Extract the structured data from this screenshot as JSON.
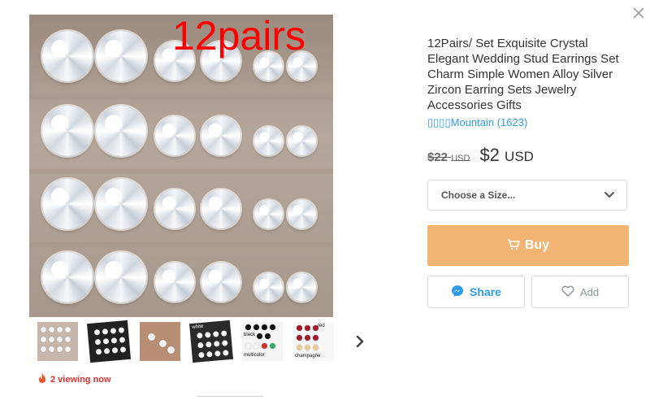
{
  "modal": {
    "close_icon": "close-icon"
  },
  "gallery": {
    "main_caption": "12pairs",
    "thumbnail_icons": [
      "thumbnail-1",
      "thumbnail-2",
      "thumbnail-3",
      "thumbnail-4",
      "thumbnail-5",
      "thumbnail-6"
    ],
    "thumbnail_texts": {
      "t4": "white",
      "t5_a": "black",
      "t5_b": "multicolor",
      "t6_a": "red",
      "t6_b": "champagne"
    },
    "next_icon": "chevron-right-icon"
  },
  "viewing": {
    "icon": "flame-icon",
    "text": "2 viewing now"
  },
  "product": {
    "title": "12Pairs/ Set Exquisite Crystal Elegant Wedding Stud Earrings Set Charm Simple Women Alloy Silver Zircon Earring Sets Jewelry Accessories Gifts",
    "store": "▯▯▯▯Mountain (1623)",
    "old_price": "$22",
    "old_currency": "USD",
    "new_price": "$2",
    "new_currency": "USD",
    "size_placeholder": "Choose a Size...",
    "buy_label": "Buy",
    "share_label": "Share",
    "add_label": "Add"
  },
  "colors": {
    "buy_button": "#f2b473",
    "link_blue": "#2f9be8",
    "viewing_red": "#e12d2d",
    "caption_red": "#ff0000"
  }
}
